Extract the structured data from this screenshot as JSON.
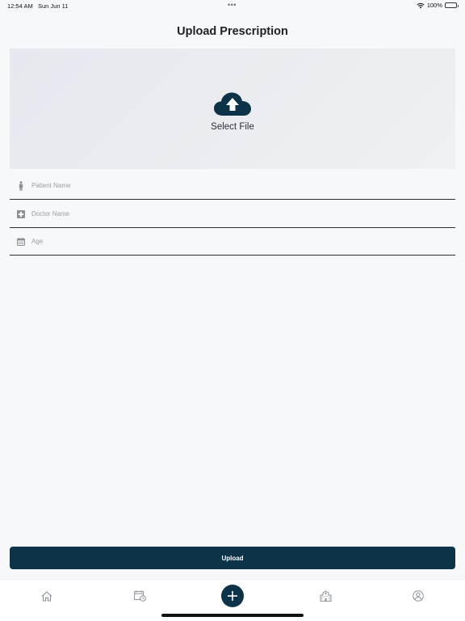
{
  "status_bar": {
    "time": "12:54 AM",
    "date": "Sun Jun 11",
    "dots": "•••",
    "battery_percent": "100%",
    "icons": [
      "wifi-icon",
      "battery-icon"
    ]
  },
  "header": {
    "title": "Upload Prescription"
  },
  "upload_area": {
    "label": "Select File",
    "icon": "cloud-upload-icon"
  },
  "form": {
    "fields": [
      {
        "icon": "person-icon",
        "placeholder": "Patient Name",
        "value": ""
      },
      {
        "icon": "medical-cross-icon",
        "placeholder": "Doctor Name",
        "value": ""
      },
      {
        "icon": "calendar-icon",
        "placeholder": "Age",
        "value": ""
      }
    ]
  },
  "actions": {
    "upload_label": "Upload"
  },
  "tab_bar": {
    "items": [
      {
        "icon": "home-icon"
      },
      {
        "icon": "calendar-clock-icon"
      },
      {
        "icon": "plus-icon",
        "active": true
      },
      {
        "icon": "hospital-icon"
      },
      {
        "icon": "profile-icon"
      }
    ]
  },
  "colors": {
    "primary": "#0c3347",
    "background": "#f7f8fa",
    "upload_area": "#e8ebf0",
    "icon_gray": "#8a8f95"
  }
}
